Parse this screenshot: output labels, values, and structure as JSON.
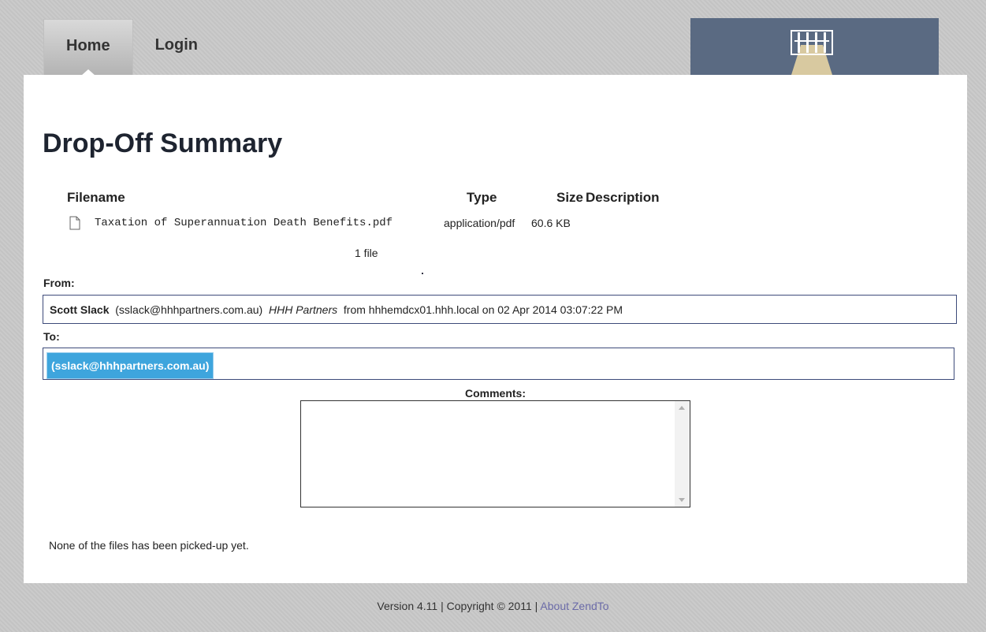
{
  "nav": {
    "tabs": [
      {
        "label": "Home",
        "active": true
      },
      {
        "label": "Login",
        "active": false
      }
    ]
  },
  "page": {
    "title": "Drop-Off Summary"
  },
  "files": {
    "headers": {
      "filename": "Filename",
      "type": "Type",
      "size": "Size",
      "description": "Description"
    },
    "rows": [
      {
        "icon": "document-icon",
        "filename": "Taxation of Superannuation Death Benefits.pdf",
        "type": "application/pdf",
        "size": "60.6 KB",
        "description": ""
      }
    ],
    "count_label": "1 file"
  },
  "from": {
    "label": "From:",
    "name": "Scott Slack",
    "email": "(sslack@hhhpartners.com.au)",
    "org": "HHH Partners",
    "details": "from hhhemdcx01.hhh.local on 02 Apr 2014  03:07:22 PM"
  },
  "to": {
    "label": "To:",
    "recipients": [
      "(sslack@hhhpartners.com.au)"
    ]
  },
  "comments": {
    "label": "Comments:",
    "value": ""
  },
  "status": "None of the files has been picked-up yet.",
  "footer": {
    "text": "Version 4.11 | Copyright © 2011  | ",
    "link": "About ZendTo"
  },
  "colors": {
    "accent": "#3ea5dd",
    "border": "#3d4b7a",
    "logo_bg": "#5a6a82",
    "link": "#6b6ba8"
  }
}
